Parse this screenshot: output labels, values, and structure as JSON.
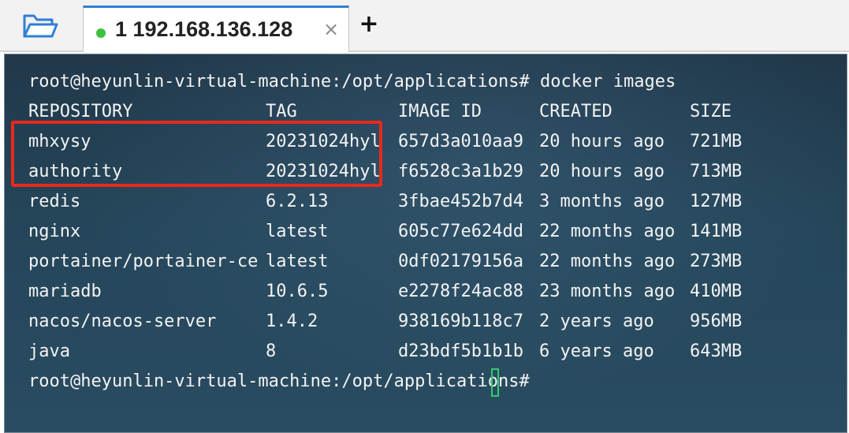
{
  "tab": {
    "label": "1 192.168.136.128",
    "close_symbol": "×",
    "status_color": "#3cc23c"
  },
  "toolbar": {
    "open_icon": "folder-open-icon",
    "new_tab_symbol": "+"
  },
  "terminal": {
    "command_line": "root@heyunlin-virtual-machine:/opt/applications# docker images",
    "headers": [
      "REPOSITORY",
      "TAG",
      "IMAGE ID",
      "CREATED",
      "SIZE"
    ],
    "rows": [
      {
        "repository": "mhxysy",
        "tag": "20231024hyl",
        "image_id": "657d3a010aa9",
        "created": "20 hours ago",
        "size": "721MB"
      },
      {
        "repository": "authority",
        "tag": "20231024hyl",
        "image_id": "f6528c3a1b29",
        "created": "20 hours ago",
        "size": "713MB"
      },
      {
        "repository": "redis",
        "tag": "6.2.13",
        "image_id": "3fbae452b7d4",
        "created": "3 months ago",
        "size": "127MB"
      },
      {
        "repository": "nginx",
        "tag": "latest",
        "image_id": "605c77e624dd",
        "created": "22 months ago",
        "size": "141MB"
      },
      {
        "repository": "portainer/portainer-ce",
        "tag": "latest",
        "image_id": "0df02179156a",
        "created": "22 months ago",
        "size": "273MB"
      },
      {
        "repository": "mariadb",
        "tag": "10.6.5",
        "image_id": "e2278f24ac88",
        "created": "23 months ago",
        "size": "410MB"
      },
      {
        "repository": "nacos/nacos-server",
        "tag": "1.4.2",
        "image_id": "938169b118c7",
        "created": "2 years ago",
        "size": "956MB"
      },
      {
        "repository": "java",
        "tag": "8",
        "image_id": "d23bdf5b1b1b",
        "created": "6 years ago",
        "size": "643MB"
      }
    ],
    "prompt": "root@heyunlin-virtual-machine:/opt/applications#",
    "highlight_color": "#e8291c",
    "cursor_color": "#2ecc71"
  }
}
